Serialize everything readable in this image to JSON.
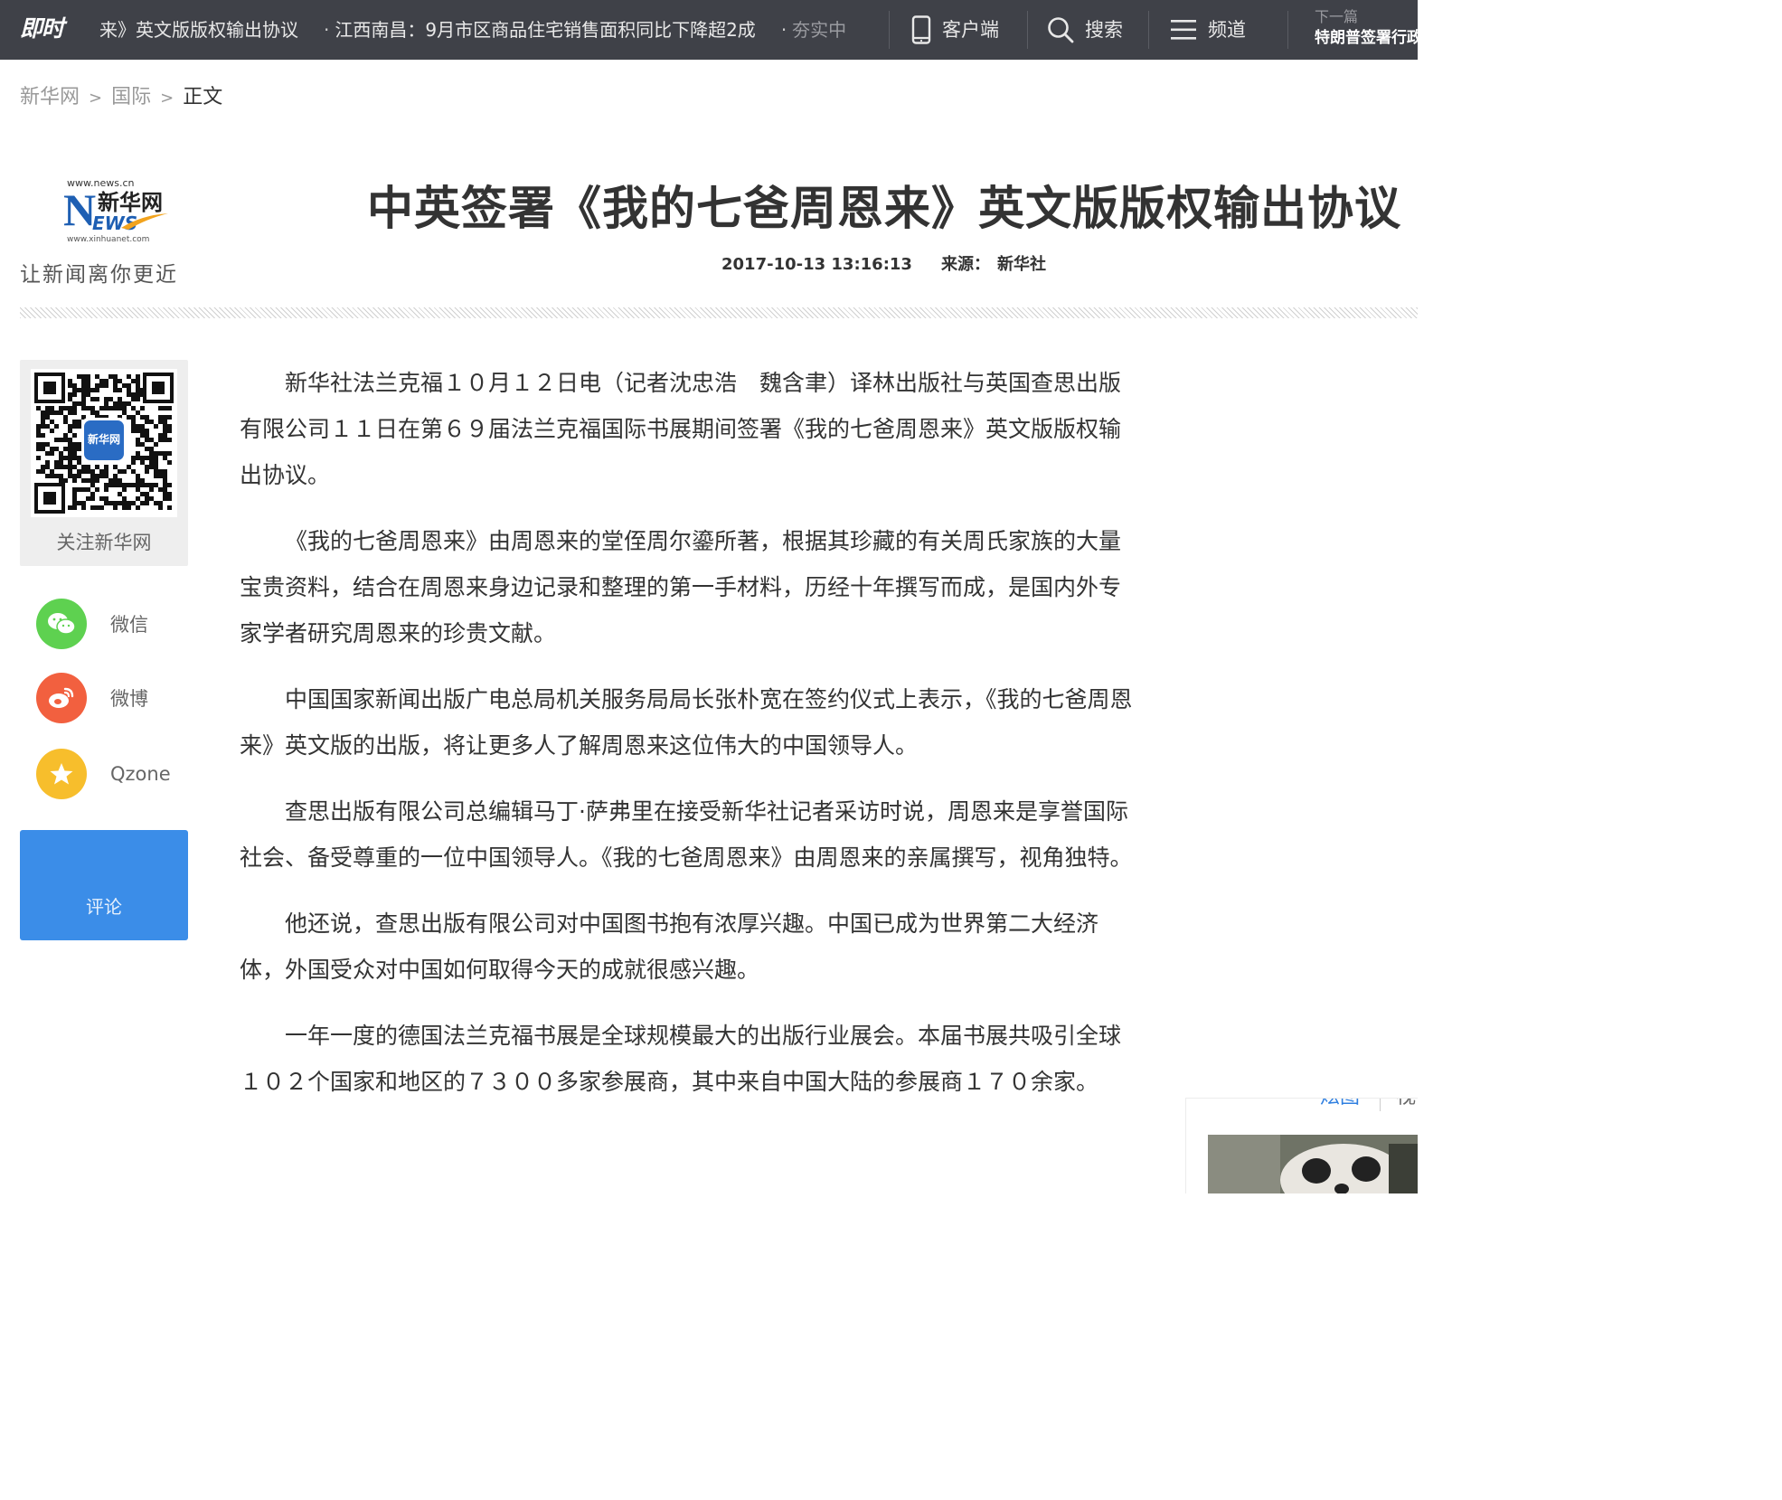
{
  "topbar": {
    "logo": "即时",
    "ticker": [
      {
        "text": "来》英文版版权输出协议",
        "style": "partial"
      },
      {
        "text": "江西南昌：9月市区商品住宅销售面积同比下降超2成",
        "style": "normal"
      },
      {
        "text": "夯实中",
        "style": "faded"
      }
    ],
    "client_label": "客户端",
    "search_label": "搜索",
    "channel_label": "频道",
    "next_label": "下一篇",
    "next_title": "特朗普签署行政"
  },
  "breadcrumb": {
    "home": "新华网",
    "section": "国际",
    "current": "正文",
    "separator": ">"
  },
  "brand": {
    "url_top": "www.news.cn",
    "name_cn": "新华网",
    "mark_n": "N",
    "mark_ews": "EWS",
    "url_bottom": "www.xinhuanet.com",
    "slogan": "让新闻离你更近"
  },
  "article": {
    "title": "中英签署《我的七爸周恩来》英文版版权输出协议",
    "datetime": "2017-10-13 13:16:13",
    "source_label": "来源：",
    "source": "新华社",
    "paragraphs": [
      "新华社法兰克福１０月１２日电（记者沈忠浩　魏含聿）译林出版社与英国查思出版有限公司１１日在第６９届法兰克福国际书展期间签署《我的七爸周恩来》英文版版权输出协议。",
      "《我的七爸周恩来》由周恩来的堂侄周尔鎏所著，根据其珍藏的有关周氏家族的大量宝贵资料，结合在周恩来身边记录和整理的第一手材料，历经十年撰写而成，是国内外专家学者研究周恩来的珍贵文献。",
      "中国国家新闻出版广电总局机关服务局局长张朴宽在签约仪式上表示，《我的七爸周恩来》英文版的出版，将让更多人了解周恩来这位伟大的中国领导人。",
      "查思出版有限公司总编辑马丁·萨弗里在接受新华社记者采访时说，周恩来是享誉国际社会、备受尊重的一位中国领导人。《我的七爸周恩来》由周恩来的亲属撰写，视角独特。",
      "他还说，查思出版有限公司对中国图书抱有浓厚兴趣。中国已成为世界第二大经济体，外国受众对中国如何取得今天的成就很感兴趣。",
      "一年一度的德国法兰克福书展是全球规模最大的出版行业展会。本届书展共吸引全球１０２个国家和地区的７３００多家参展商，其中来自中国大陆的参展商１７０余家。"
    ]
  },
  "sidebar": {
    "qr_label": "关注新华网",
    "qr_badge": "新华网",
    "share": [
      {
        "label": "微信",
        "color": "#5ed150",
        "icon": "wechat-icon"
      },
      {
        "label": "微博",
        "color": "#f2603f",
        "icon": "weibo-icon"
      },
      {
        "label": "Qzone",
        "color": "#f7be2c",
        "icon": "qzone-icon"
      }
    ],
    "comment_label": "评论"
  },
  "right_widget": {
    "tab_pictures": "炫图",
    "tab_video": "视"
  },
  "colors": {
    "topbar_bg": "#3f4148",
    "accent_blue": "#3b8de8",
    "link_blue": "#2f7fe0"
  }
}
